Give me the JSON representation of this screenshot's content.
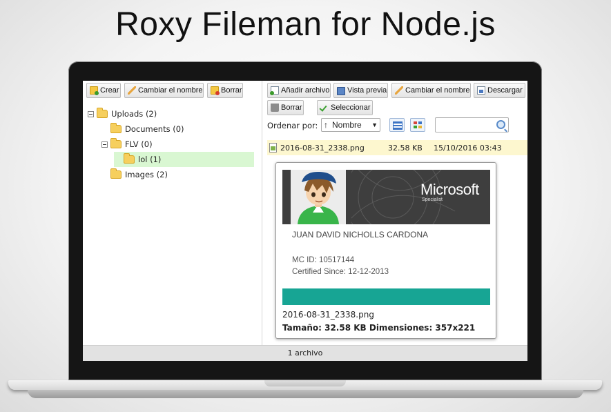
{
  "hero": {
    "title": "Roxy Fileman for Node.js"
  },
  "left_toolbar": {
    "create_label": "Crear",
    "rename_label": "Cambiar el nombre",
    "delete_label": "Borrar"
  },
  "tree": {
    "items": [
      {
        "label": "Uploads (2)",
        "expanded": true
      },
      {
        "label": "Documents (0)"
      },
      {
        "label": "FLV (0)",
        "expanded": true
      },
      {
        "label": "lol (1)",
        "selected": true
      },
      {
        "label": "Images (2)"
      }
    ]
  },
  "right_toolbar": {
    "add_file_label": "Añadir archivo",
    "preview_label": "Vista previa",
    "rename_label": "Cambiar el nombre",
    "download_label": "Descargar",
    "delete_label": "Borrar",
    "select_label": "Seleccionar"
  },
  "sort": {
    "label": "Ordenar por:",
    "direction": "↑",
    "selected": "Nombre"
  },
  "search": {
    "placeholder": ""
  },
  "files": [
    {
      "name": "2016-08-31_2338.png",
      "size": "32.58 KB",
      "date": "15/10/2016 03:43"
    }
  ],
  "preview": {
    "cert_brand": "Microsoft",
    "cert_brand_sub": "Specialist",
    "cert_name": "JUAN DAVID NICHOLLS CARDONA",
    "cert_id": "MC ID: 10517144",
    "cert_since": "Certified Since: 12-12-2013",
    "file_name": "2016-08-31_2338.png",
    "file_info": "Tamaño: 32.58 KB Dimensiones: 357x221"
  },
  "status": {
    "text": "1 archivo"
  },
  "colors": {
    "selected_folder_bg": "#d9f7d2",
    "file_row_bg": "#fdf7cf",
    "cert_bar": "#17a594"
  }
}
